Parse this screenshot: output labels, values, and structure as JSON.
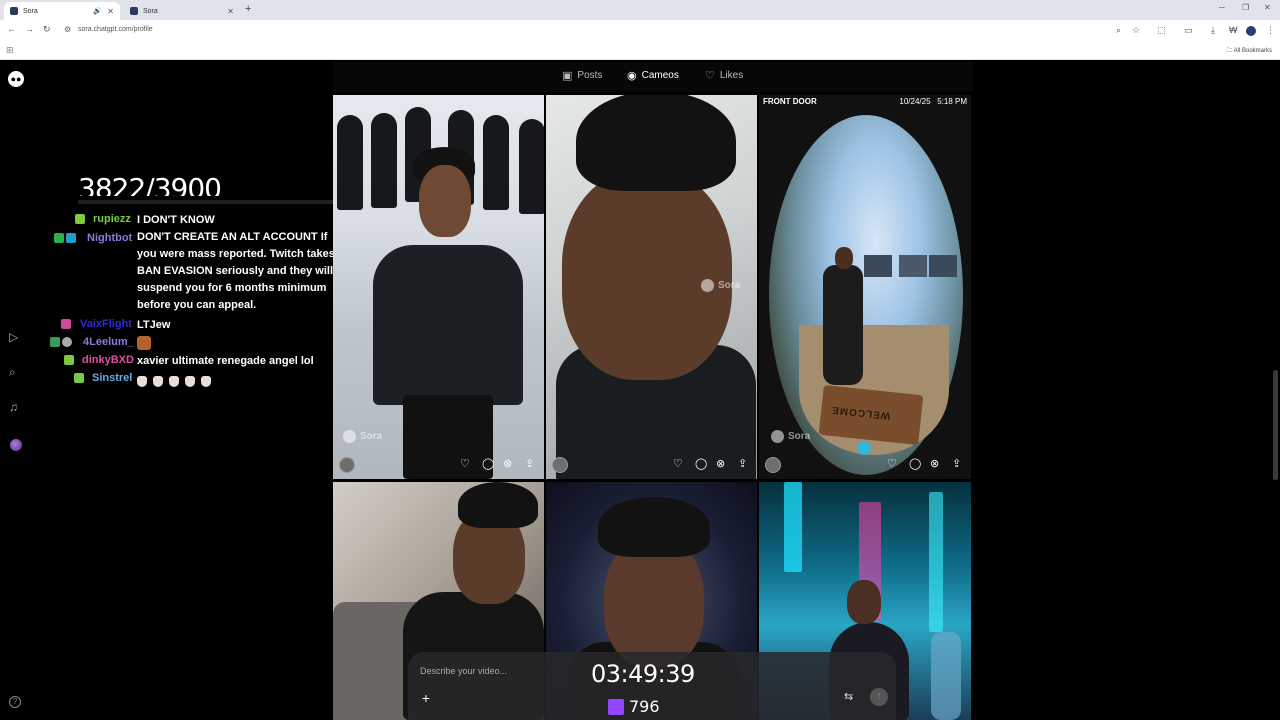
{
  "browser": {
    "tabs": [
      {
        "title": "Sora",
        "active": true
      },
      {
        "title": "Sora",
        "active": false
      }
    ],
    "url": "sora.chatgpt.com/profile",
    "all_bookmarks": "All Bookmarks"
  },
  "stream": {
    "counter": "3822/3900",
    "timer": "03:49:39",
    "viewers": "796",
    "chat": [
      {
        "user": "rupiezz",
        "user_color": "#7ac943",
        "message": "I DON'T KNOW"
      },
      {
        "user": "Nightbot",
        "user_color": "#8b7bd8",
        "message": "DON'T CREATE AN ALT ACCOUNT If you were mass reported. Twitch takes BAN EVASION seriously and they will suspend you for 6 months minimum before you can appeal."
      },
      {
        "user": "VaixFlight",
        "user_color": "#2b2bd6",
        "message": "LTJew"
      },
      {
        "user": "4Leelum_",
        "user_color": "#8b7bd8",
        "message": ""
      },
      {
        "user": "dinkyBXD",
        "user_color": "#e04ea4",
        "message": "xavier ultimate renegade angel lol"
      },
      {
        "user": "Sinstrel",
        "user_color": "#6aa8e8",
        "message": ""
      }
    ]
  },
  "profile_tabs": [
    {
      "label": "Posts",
      "icon": "play-square-icon",
      "active": false
    },
    {
      "label": "Cameos",
      "icon": "person-circle-icon",
      "active": true
    },
    {
      "label": "Likes",
      "icon": "heart-icon",
      "active": false
    }
  ],
  "grid": {
    "watermark": "Sora",
    "doorbell": {
      "label": "FRONT DOOR",
      "timestamp": "10/24/25   5:18 PM",
      "mat_text": "WELCOME"
    }
  },
  "composer": {
    "placeholder": "Describe your video..."
  },
  "colors": {
    "background": "#000000",
    "accent": "#35b6dc",
    "twitch": "#9146ff"
  }
}
